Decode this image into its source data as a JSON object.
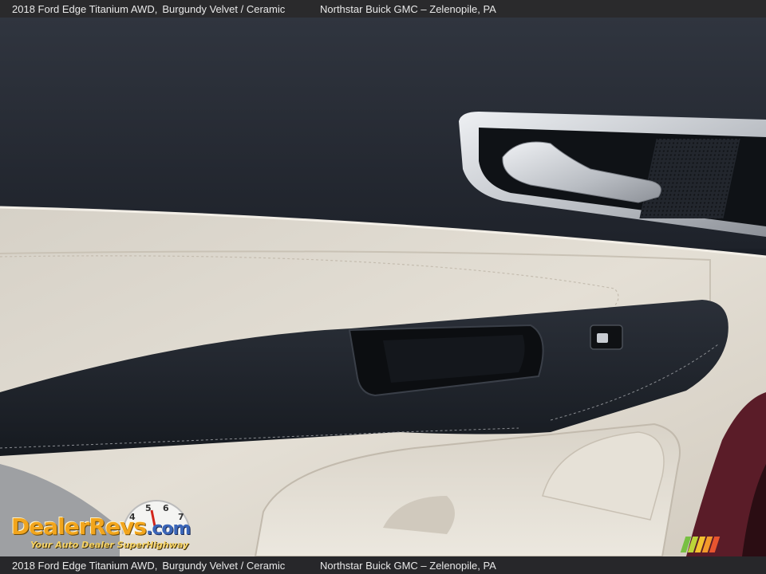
{
  "caption": {
    "vehicle": "2018 Ford Edge Titanium AWD,",
    "colors": "Burgundy Velvet / Ceramic",
    "dealer": "Northstar Buick GMC – Zelenopile, PA"
  },
  "watermark": {
    "brand_main": "DealerRevs",
    "brand_suffix": ".com",
    "tagline": "Your Auto Dealer SuperHighway",
    "gauge_digits": [
      "4",
      "5",
      "6",
      "7"
    ]
  },
  "colors": {
    "upper_trim": "#272c36",
    "leather": "#ddd7cc",
    "armrest": "#1f232b",
    "chrome": "#c9ccd1",
    "logo_orange": "#f2a51c",
    "logo_blue": "#3b66b8",
    "stripes": [
      "#78c043",
      "#bcd43a",
      "#f2c230",
      "#f39a2b",
      "#e8552f"
    ]
  }
}
